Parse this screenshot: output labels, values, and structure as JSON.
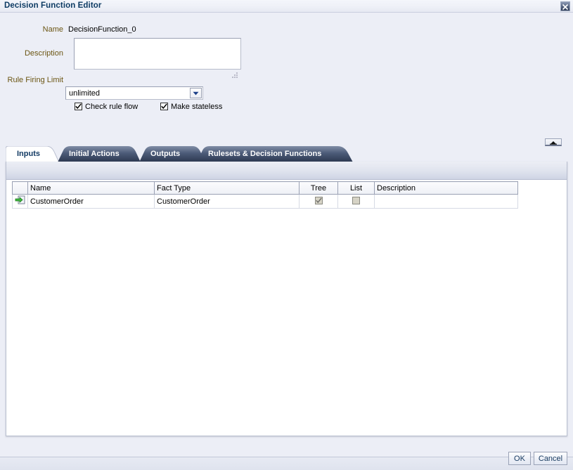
{
  "window": {
    "title": "Decision Function Editor",
    "close_icon": "close-icon"
  },
  "form": {
    "name_label": "Name",
    "name_value": "DecisionFunction_0",
    "description_label": "Description",
    "description_value": "",
    "description_placeholder": "",
    "rule_firing_limit_label": "Rule Firing Limit",
    "rule_firing_limit_value": "unlimited",
    "rule_firing_limit_options": [
      "unlimited"
    ],
    "dropdown_icon": "chevron-down-icon",
    "checkboxes": [
      {
        "label": "Check rule flow",
        "checked": true
      },
      {
        "label": "Make stateless",
        "checked": true
      }
    ]
  },
  "collapse": {
    "icon": "chevron-up-icon",
    "label": ""
  },
  "tabs": [
    {
      "label": "Inputs",
      "active": true
    },
    {
      "label": "Initial Actions",
      "active": false
    },
    {
      "label": "Outputs",
      "active": false
    },
    {
      "label": "Rulesets & Decision Functions",
      "active": false
    }
  ],
  "table": {
    "columns": [
      "",
      "Name",
      "Fact Type",
      "Tree",
      "List",
      "Description"
    ],
    "rows": [
      {
        "icon": "input-document-icon",
        "name": "CustomerOrder",
        "fact_type": "CustomerOrder",
        "tree": true,
        "list": false,
        "description": ""
      }
    ]
  },
  "footer": {
    "ok_label": "OK",
    "cancel_label": "Cancel"
  },
  "colors": {
    "title_text": "#0d3b63",
    "label_text": "#6b5512",
    "dialog_background": "#eceef6",
    "panel_background": "#ffffff",
    "tab_active_text": "#123a63",
    "tab_inactive_text": "#ffffff",
    "button_text": "#16395f"
  }
}
